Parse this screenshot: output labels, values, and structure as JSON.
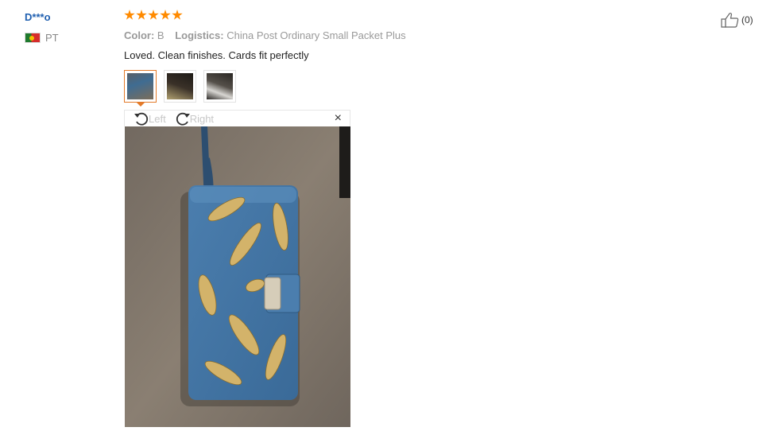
{
  "reviewer": {
    "name": "D***o",
    "country_code": "PT",
    "flag_icon": "portugal-flag-icon"
  },
  "review": {
    "rating": 5,
    "rating_max": 5,
    "star_color": "#ff8a00",
    "color_label": "Color:",
    "color_value": "B",
    "logistics_label": "Logistics:",
    "logistics_value": "China Post Ordinary Small Packet Plus",
    "text": "Loved. Clean finishes. Cards fit perfectly"
  },
  "thumbnails": [
    {
      "name": "review-photo-1",
      "active": true
    },
    {
      "name": "review-photo-2",
      "active": false
    },
    {
      "name": "review-photo-3",
      "active": false
    }
  ],
  "viewer": {
    "rotate_left_label": "Left",
    "rotate_right_label": "Right",
    "close_glyph": "×"
  },
  "helpful": {
    "count_label": "(0)",
    "icon": "thumbs-up-icon"
  },
  "colors": {
    "accent": "#e37a29",
    "username": "#1f5fb0"
  }
}
